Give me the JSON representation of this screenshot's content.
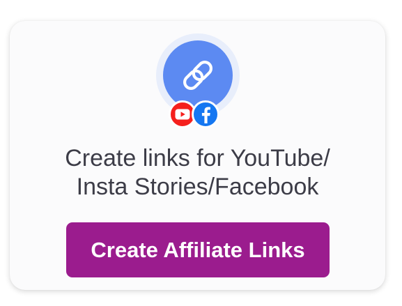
{
  "card": {
    "icons": {
      "main": "link-icon",
      "badges": [
        "youtube-icon",
        "facebook-icon"
      ]
    },
    "description": {
      "line1": "Create links for YouTube/",
      "line2": "Insta Stories/Facebook"
    },
    "cta_label": "Create Affiliate Links"
  },
  "colors": {
    "icon_circle": "#5c8af2",
    "icon_halo": "#e8eefb",
    "youtube_red": "#f5201d",
    "facebook_blue": "#1577f1",
    "button_background": "#9b1c8e",
    "text": "#3c3c47"
  }
}
